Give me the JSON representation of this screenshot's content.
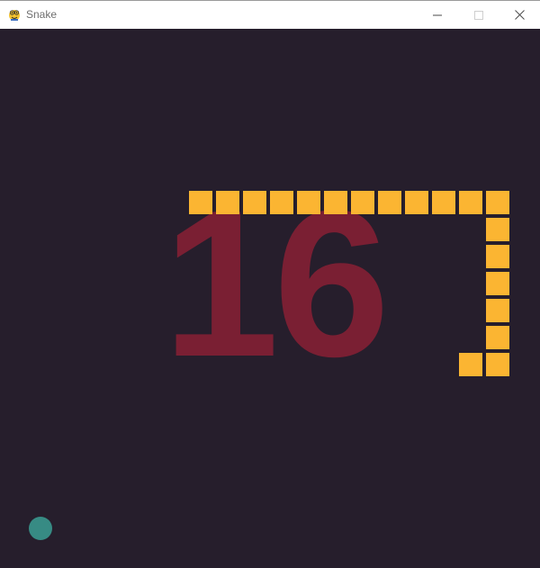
{
  "window": {
    "title": "Snake",
    "icon": "pygame-snake-icon",
    "controls": [
      "minimize-icon",
      "maximize-icon",
      "close-icon"
    ]
  },
  "game": {
    "score": "16",
    "colors": {
      "background": "#261e2c",
      "score": "#7a1f33",
      "snake": "#fbb532",
      "food": "#378b84"
    }
  }
}
